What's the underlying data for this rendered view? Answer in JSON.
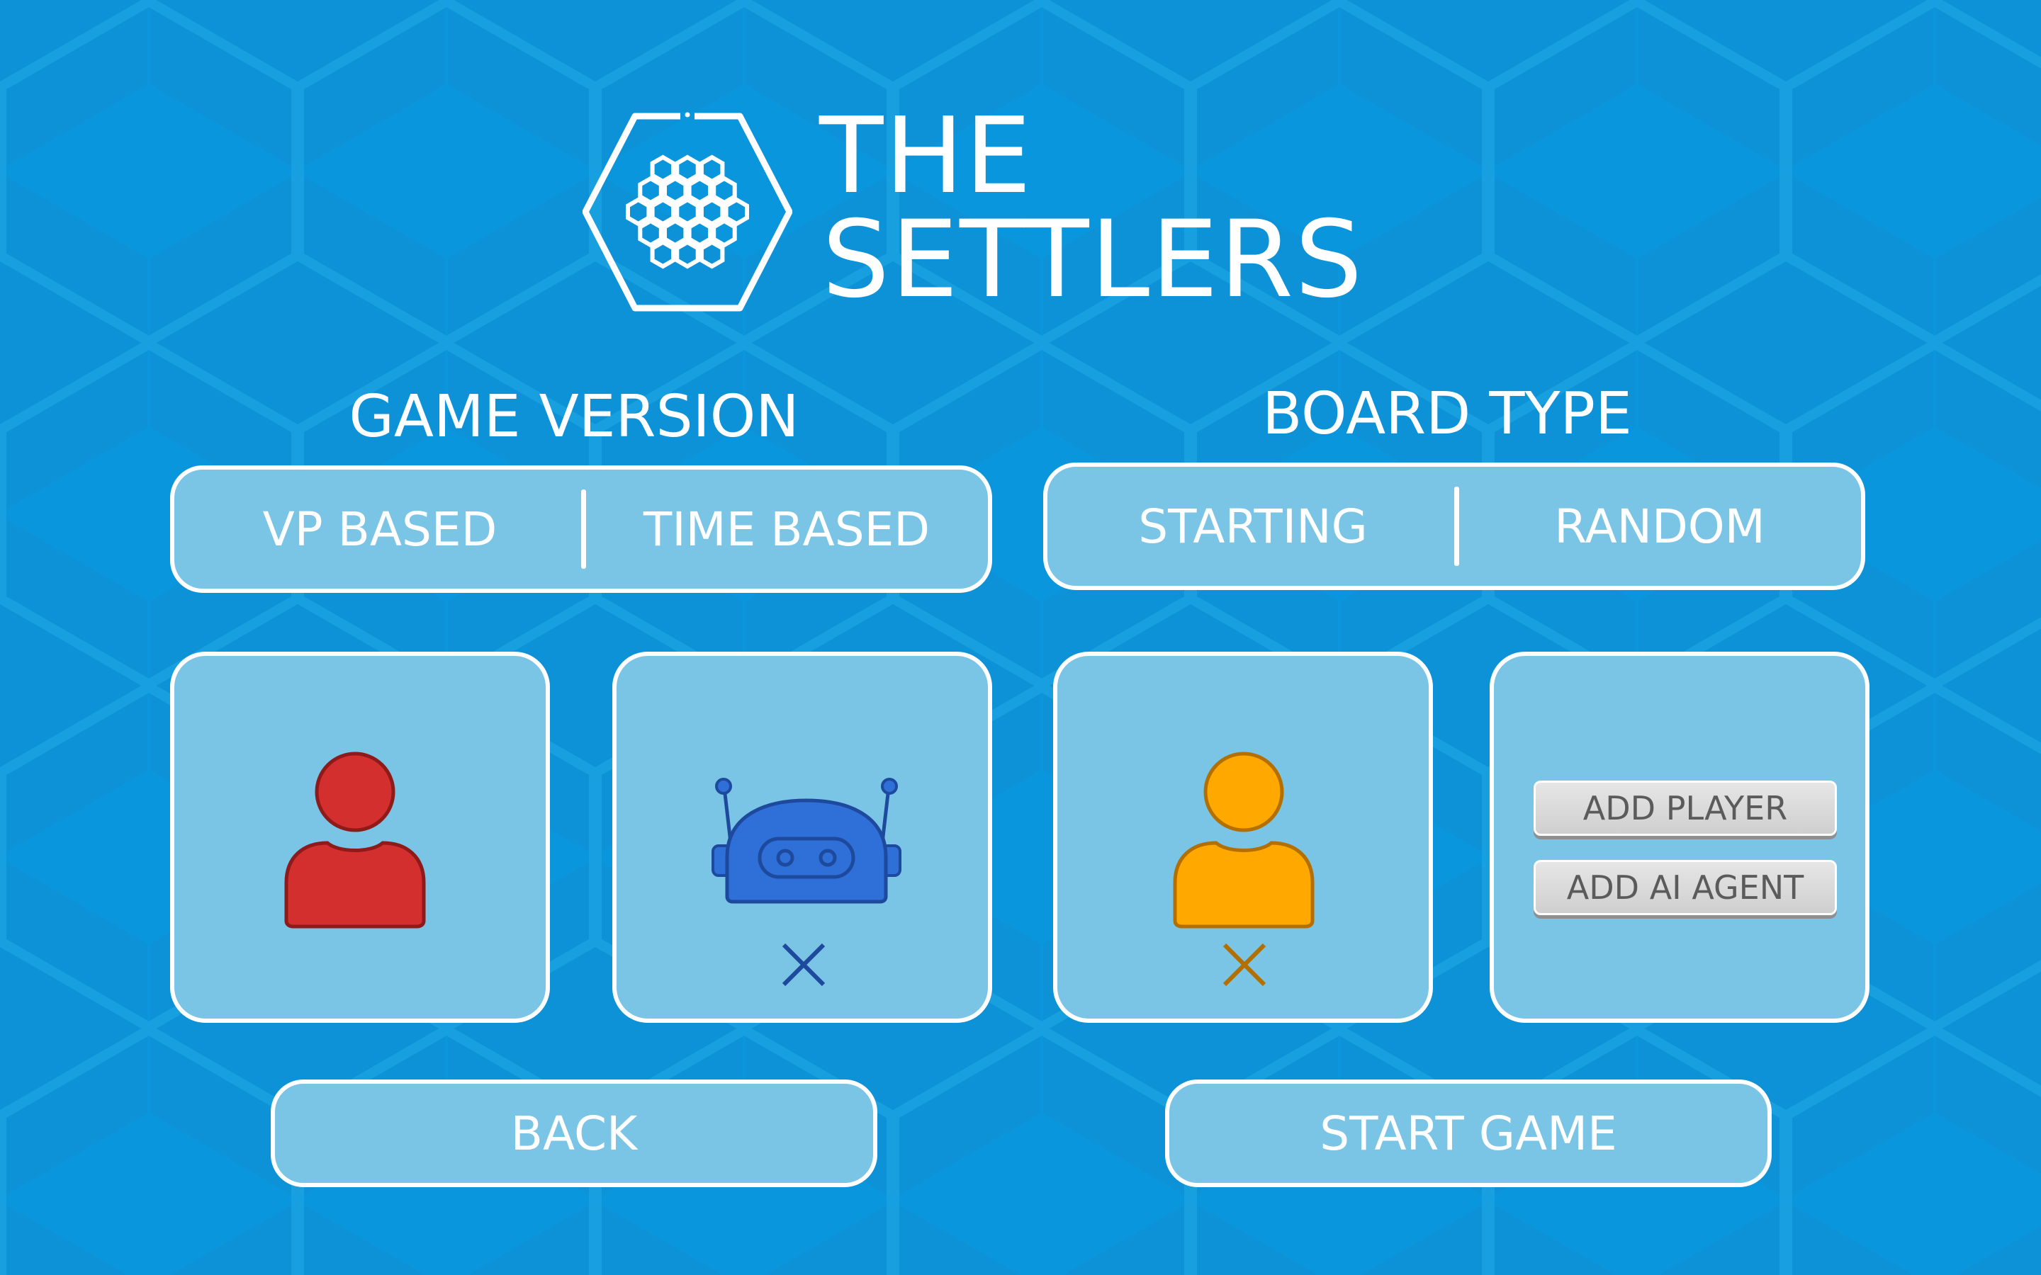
{
  "logo": {
    "line1": "THE",
    "line2": "SETTLERS",
    "icon": "hexagon-honeycomb-icon"
  },
  "game_version": {
    "title": "GAME VERSION",
    "options": [
      "VP BASED",
      "TIME BASED"
    ]
  },
  "board_type": {
    "title": "BOARD TYPE",
    "options": [
      "STARTING",
      "RANDOM"
    ]
  },
  "players": [
    {
      "type": "human",
      "color": "#d32f2f",
      "icon": "person-icon",
      "removable": false
    },
    {
      "type": "ai",
      "color": "#2f6fd8",
      "icon": "robot-icon",
      "removable": true
    },
    {
      "type": "human",
      "color": "#ffa800",
      "icon": "person-icon",
      "removable": true
    },
    {
      "type": "empty"
    }
  ],
  "add_slot": {
    "add_player": "ADD PLAYER",
    "add_ai_agent": "ADD AI AGENT"
  },
  "buttons": {
    "back": "BACK",
    "start_game": "START GAME"
  },
  "colors": {
    "background": "#0a96dc",
    "panel": "#7ac4e6",
    "border": "#ffffff"
  }
}
